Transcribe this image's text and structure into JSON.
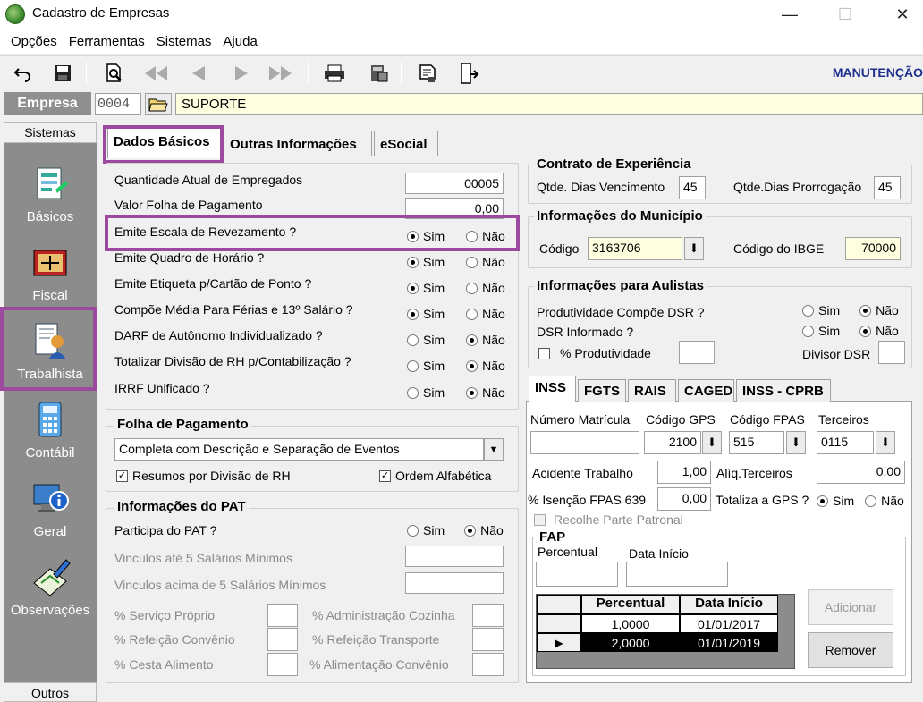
{
  "window": {
    "title": "Cadastro de Empresas",
    "controls": [
      "—",
      "☐",
      "✕"
    ]
  },
  "menu": [
    "Opções",
    "Ferramentas",
    "Sistemas",
    "Ajuda"
  ],
  "toolbar": {
    "mode": "MANUTENÇÃO"
  },
  "empresa": {
    "label": "Empresa",
    "code": "0004",
    "name": "SUPORTE"
  },
  "sidebar": {
    "header": "Sistemas",
    "footer": "Outros",
    "items": [
      {
        "label": "Básicos"
      },
      {
        "label": "Fiscal"
      },
      {
        "label": "Trabalhista"
      },
      {
        "label": "Contábil"
      },
      {
        "label": "Geral"
      },
      {
        "label": "Observações"
      }
    ]
  },
  "tabs": {
    "dados_basicos": "Dados Básicos",
    "outras": "Outras Informações",
    "esocial": "eSocial"
  },
  "basicos": {
    "qtd_empregados": {
      "label": "Quantidade Atual de Empregados",
      "value": "00005"
    },
    "valor_folha": {
      "label": "Valor Folha de Pagamento",
      "value": "0,00"
    },
    "sim": "Sim",
    "nao": "Não",
    "questions": [
      {
        "label": "Emite Escala de Revezamento ?",
        "selected": "sim"
      },
      {
        "label": "Emite Quadro de Horário ?",
        "selected": "sim"
      },
      {
        "label": "Emite Etiqueta p/Cartão de Ponto ?",
        "selected": "sim"
      },
      {
        "label": "Compõe Média Para Férias e 13º Salário ?",
        "selected": "sim"
      },
      {
        "label": "DARF de Autônomo Individualizado ?",
        "selected": "nao"
      },
      {
        "label": "Totalizar Divisão de RH p/Contabilização ?",
        "selected": "nao"
      },
      {
        "label": "IRRF Unificado ?",
        "selected": "nao"
      }
    ]
  },
  "folha": {
    "title": "Folha de Pagamento",
    "tipo": "Completa com Descrição e Separação de Eventos",
    "resumos": "Resumos por Divisão de RH",
    "ordem": "Ordem Alfabética"
  },
  "pat": {
    "title": "Informações do PAT",
    "participa": "Participa do PAT ?",
    "participa_selected": "nao",
    "vinc_ate": "Vinculos até 5 Salários Mínimos",
    "vinc_acima": "Vinculos acima de 5 Salários Mínimos",
    "servico": "% Serviço Próprio",
    "adm_cozinha": "% Administração Cozinha",
    "refeicao_conv": "% Refeição Convênio",
    "refeicao_transp": "% Refeição Transporte",
    "cesta": "% Cesta Alimento",
    "alim_conv": "% Alimentação Convênio"
  },
  "contrato": {
    "title": "Contrato de Experiência",
    "venc_label": "Qtde. Dias Vencimento",
    "venc": "45",
    "prorr_label": "Qtde.Dias Prorrogação",
    "prorr": "45"
  },
  "municipio": {
    "title": "Informações do Município",
    "codigo_label": "Código",
    "codigo": "3163706",
    "ibge_label": "Código do IBGE",
    "ibge": "70000"
  },
  "aulistas": {
    "title": "Informações para Aulistas",
    "prod_label": "Produtividade Compõe DSR ?",
    "prod_selected": "nao",
    "dsr_label": "DSR Informado ?",
    "dsr_selected": "nao",
    "perc_prod": "% Produtividade",
    "divisor": "Divisor DSR"
  },
  "subtabs": [
    "INSS",
    "FGTS",
    "RAIS",
    "CAGED",
    "INSS - CPRB"
  ],
  "inss": {
    "matricula_label": "Número Matrícula",
    "gps_label": "Código GPS",
    "gps": "2100",
    "fpas_label": "Código FPAS",
    "fpas": "515",
    "terceiros_label": "Terceiros",
    "terceiros": "0115",
    "acidente_label": "Acidente Trabalho",
    "acidente": "1,00",
    "aliq_label": "Alíq.Terceiros",
    "aliq": "0,00",
    "isencao_label": "% Isenção FPAS 639",
    "isencao": "0,00",
    "totaliza_label": "Totaliza a GPS ?",
    "totaliza_selected": "sim",
    "recolhe": "Recolhe Parte Patronal"
  },
  "fap": {
    "title": "FAP",
    "perc_label": "Percentual",
    "data_label": "Data Início",
    "grid_headers": [
      "Percentual",
      "Data Início"
    ],
    "rows": [
      {
        "perc": "1,0000",
        "data": "01/01/2017",
        "selected": false
      },
      {
        "perc": "2,0000",
        "data": "01/01/2019",
        "selected": true
      }
    ],
    "adicionar": "Adicionar",
    "remover": "Remover"
  }
}
